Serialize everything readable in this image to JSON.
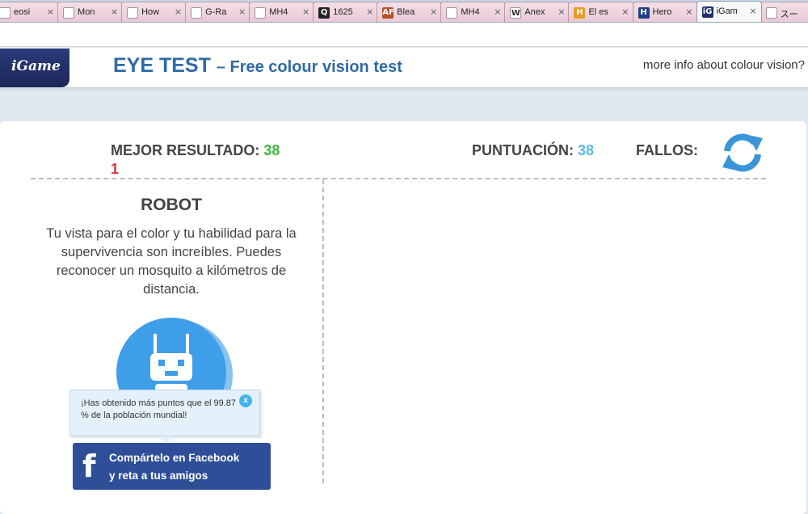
{
  "browser": {
    "tabs": [
      {
        "label": "eosi",
        "fav": "",
        "favColor": "#ffffff"
      },
      {
        "label": "Mon",
        "fav": "",
        "favColor": "#ffffff"
      },
      {
        "label": "How",
        "fav": "",
        "favColor": "#ffffff"
      },
      {
        "label": "G-Ra",
        "fav": "",
        "favColor": "#ffffff"
      },
      {
        "label": "MH4",
        "fav": "",
        "favColor": "#ffffff"
      },
      {
        "label": "1625",
        "fav": "Q",
        "favColor": "#222222"
      },
      {
        "label": "Blea",
        "fav": "AF",
        "favColor": "#b5502a"
      },
      {
        "label": "MH4",
        "fav": "",
        "favColor": "#ffffff"
      },
      {
        "label": "Anex",
        "fav": "W",
        "favColor": "#ffffff"
      },
      {
        "label": "El es",
        "fav": "H",
        "favColor": "#e79b2a"
      },
      {
        "label": "Hero",
        "fav": "H",
        "favColor": "#1d3c8a"
      },
      {
        "label": "iGam",
        "fav": "iG",
        "favColor": "#1f2f6b"
      },
      {
        "label": "スー",
        "fav": "",
        "favColor": "#ffffff"
      }
    ],
    "active_tab_index": 11
  },
  "header": {
    "logo": "iGame",
    "title": "EYE TEST",
    "subtitle": "– Free colour vision test",
    "more_info": "more info about colour vision?"
  },
  "scores": {
    "best_label": "MEJOR RESULTADO:",
    "best_value": "38",
    "best_extra": "1",
    "score_label": "PUNTUACIÓN:",
    "score_value": "38",
    "errors_label": "FALLOS:"
  },
  "result": {
    "title": "ROBOT",
    "description": "Tu vista para el color y tu habilidad para la supervivencia son increíbles. Puedes reconocer un mosquito a kilómetros de distancia."
  },
  "tooltip": {
    "text": "¡Has obtenido más puntos que el 99.87 % de la población mundial!",
    "close": "x"
  },
  "facebook": {
    "icon": "f",
    "line1": "Compártelo en Facebook",
    "line2": "y reta a tus amigos"
  },
  "colors": {
    "brand_blue": "#2f6aa5",
    "best_green": "#3db83d",
    "score_blue": "#5fb7e6",
    "error_red": "#d9363e",
    "facebook_blue": "#2e4f98"
  }
}
